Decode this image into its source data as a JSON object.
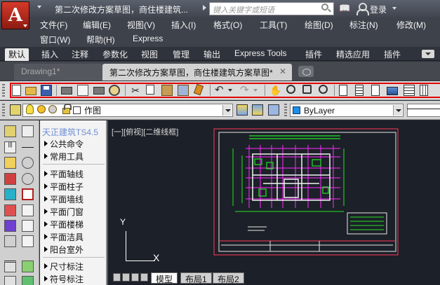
{
  "title": {
    "document": "第二次修改方案草图，商住楼建筑...",
    "search_placeholder": "键入关键字或短语",
    "login": "登录"
  },
  "menu": {
    "row1": [
      "文件(F)",
      "编辑(E)",
      "视图(V)",
      "插入(I)",
      "格式(O)",
      "工具(T)",
      "绘图(D)",
      "标注(N)",
      "修改(M)"
    ],
    "row2": [
      "窗口(W)",
      "帮助(H)",
      "Express"
    ]
  },
  "ribbon_tabs": [
    "默认",
    "插入",
    "注释",
    "参数化",
    "视图",
    "管理",
    "输出",
    "Express Tools",
    "插件",
    "精选应用",
    "插件"
  ],
  "doc_tabs": {
    "inactive": "Drawing1*",
    "active": "第二次修改方案草图，商住楼建筑方案草图*",
    "close": "✕"
  },
  "layer_toolbar": {
    "layer_name": "作图",
    "color_value": "ByLayer"
  },
  "tianzheng": {
    "title": "天正建筑TS4.5",
    "items": [
      "公共命令",
      "常用工具",
      "平面轴线",
      "平面柱子",
      "平面墙线",
      "平面门窗",
      "平面楼梯",
      "平面洁具",
      "阳台室外",
      "尺寸标注",
      "符号标注"
    ]
  },
  "canvas": {
    "viewport_label": "[一][俯视][二维线框]",
    "axis_y": "Y",
    "axis_x": "X",
    "layout_tabs": [
      "模型",
      "布局1",
      "布局2"
    ]
  },
  "colors": {
    "frame_red": "#e00000",
    "drawing_green": "#24e324",
    "drawing_magenta": "#ff2bff",
    "drawing_white": "#f2f2f2"
  }
}
